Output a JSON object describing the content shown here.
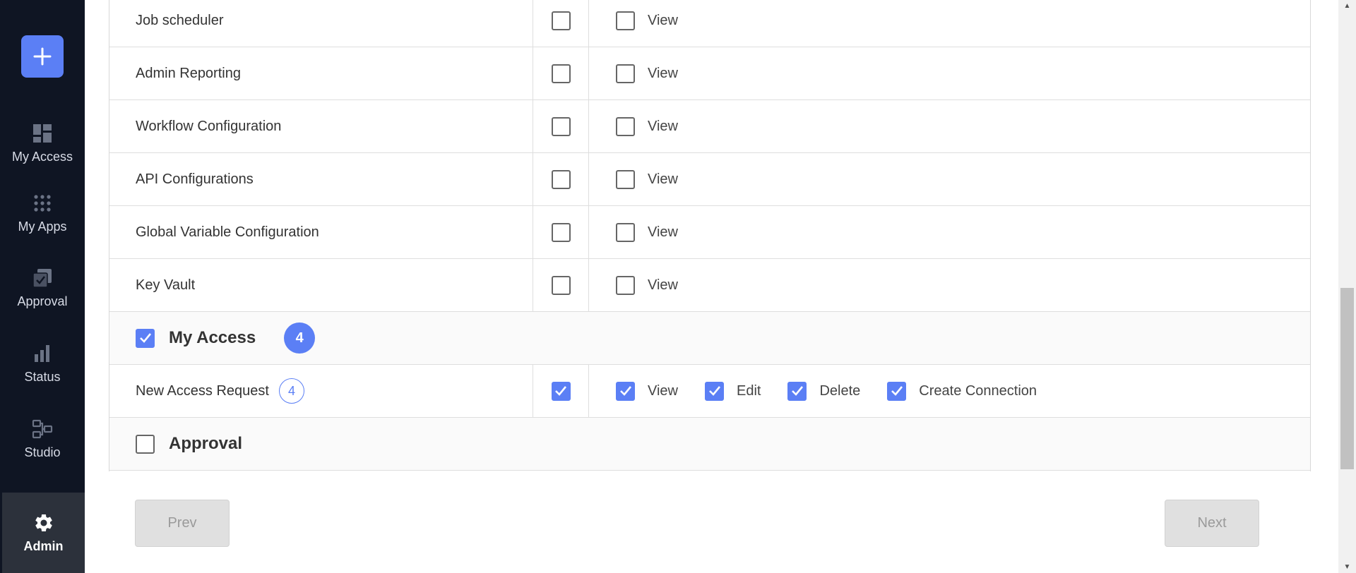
{
  "sidebar": {
    "items": [
      {
        "label": "My Access",
        "icon": "dashboard-icon"
      },
      {
        "label": "My Apps",
        "icon": "apps-grid-icon"
      },
      {
        "label": "Approval",
        "icon": "approval-icon"
      },
      {
        "label": "Status",
        "icon": "bar-chart-icon"
      },
      {
        "label": "Studio",
        "icon": "studio-icon"
      },
      {
        "label": "Admin",
        "icon": "gear-icon",
        "active": true
      }
    ]
  },
  "rows": [
    {
      "name": "Job scheduler",
      "all_checked": false,
      "perms": [
        {
          "label": "View",
          "checked": false
        }
      ]
    },
    {
      "name": "Admin Reporting",
      "all_checked": false,
      "perms": [
        {
          "label": "View",
          "checked": false
        }
      ]
    },
    {
      "name": "Workflow Configuration",
      "all_checked": false,
      "perms": [
        {
          "label": "View",
          "checked": false
        }
      ]
    },
    {
      "name": "API Configurations",
      "all_checked": false,
      "perms": [
        {
          "label": "View",
          "checked": false
        }
      ]
    },
    {
      "name": "Global Variable Configuration",
      "all_checked": false,
      "perms": [
        {
          "label": "View",
          "checked": false
        }
      ]
    },
    {
      "name": "Key Vault",
      "all_checked": false,
      "perms": [
        {
          "label": "View",
          "checked": false
        }
      ]
    }
  ],
  "section_my_access": {
    "title": "My Access",
    "checked": true,
    "count": "4"
  },
  "new_access_request": {
    "name": "New Access Request",
    "count": "4",
    "all_checked": true,
    "perms": [
      {
        "label": "View",
        "checked": true
      },
      {
        "label": "Edit",
        "checked": true
      },
      {
        "label": "Delete",
        "checked": true
      },
      {
        "label": "Create Connection",
        "checked": true
      }
    ]
  },
  "section_approval": {
    "title": "Approval",
    "checked": false
  },
  "footer": {
    "prev_label": "Prev",
    "next_label": "Next"
  },
  "colors": {
    "accent": "#5b7ff5",
    "sidebar_bg": "#0f1523"
  }
}
